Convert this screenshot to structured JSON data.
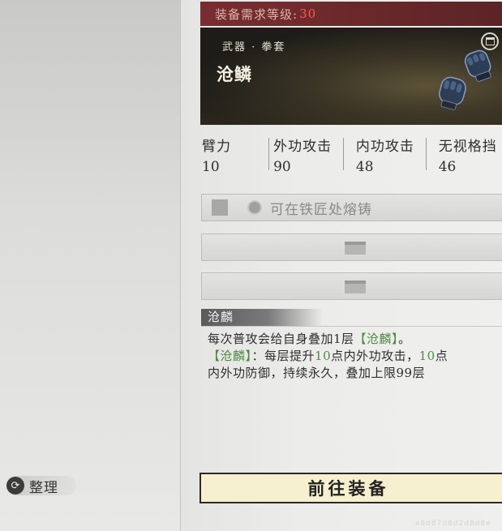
{
  "left_panel": {
    "sort_label": "整理",
    "sort_icon": "cycle-arrow-icon"
  },
  "requirement": {
    "label": "装备需求等级:",
    "value": "30"
  },
  "item": {
    "type": "武器 · 拳套",
    "name": "沧鳞",
    "icon": "gauntlets-icon",
    "corner_icon": "lock-icon"
  },
  "stats": [
    {
      "label": "臂力",
      "value": "10"
    },
    {
      "label": "外功攻击",
      "value": "90"
    },
    {
      "label": "内功攻击",
      "value": "48"
    },
    {
      "label": "无视格挡",
      "value": "46"
    }
  ],
  "forge": {
    "text": "可在铁匠处熔铸"
  },
  "skill": {
    "name": "沧麟",
    "line1": "每次普攻会给自身叠加1层",
    "line1_hl": "【沧麟】",
    "line1_end": "。",
    "line2_hl_a": "【沧麟】",
    "line2_a": "：每层提升",
    "line2_hl_b": "10",
    "line2_b": "点内外功攻击，",
    "line2_hl_c": "10",
    "line2_c": "点",
    "line3": "内外功防御，持续永久，叠加上限99层"
  },
  "actions": {
    "equip_label": "前往装备"
  },
  "watermark": "a8d87d8d2d8d8e",
  "colors": {
    "req_bg": "#6b2a2c",
    "req_value": "#ff5a4d",
    "highlight": "#4f8a48",
    "button_bg": "#f6f0cf"
  }
}
